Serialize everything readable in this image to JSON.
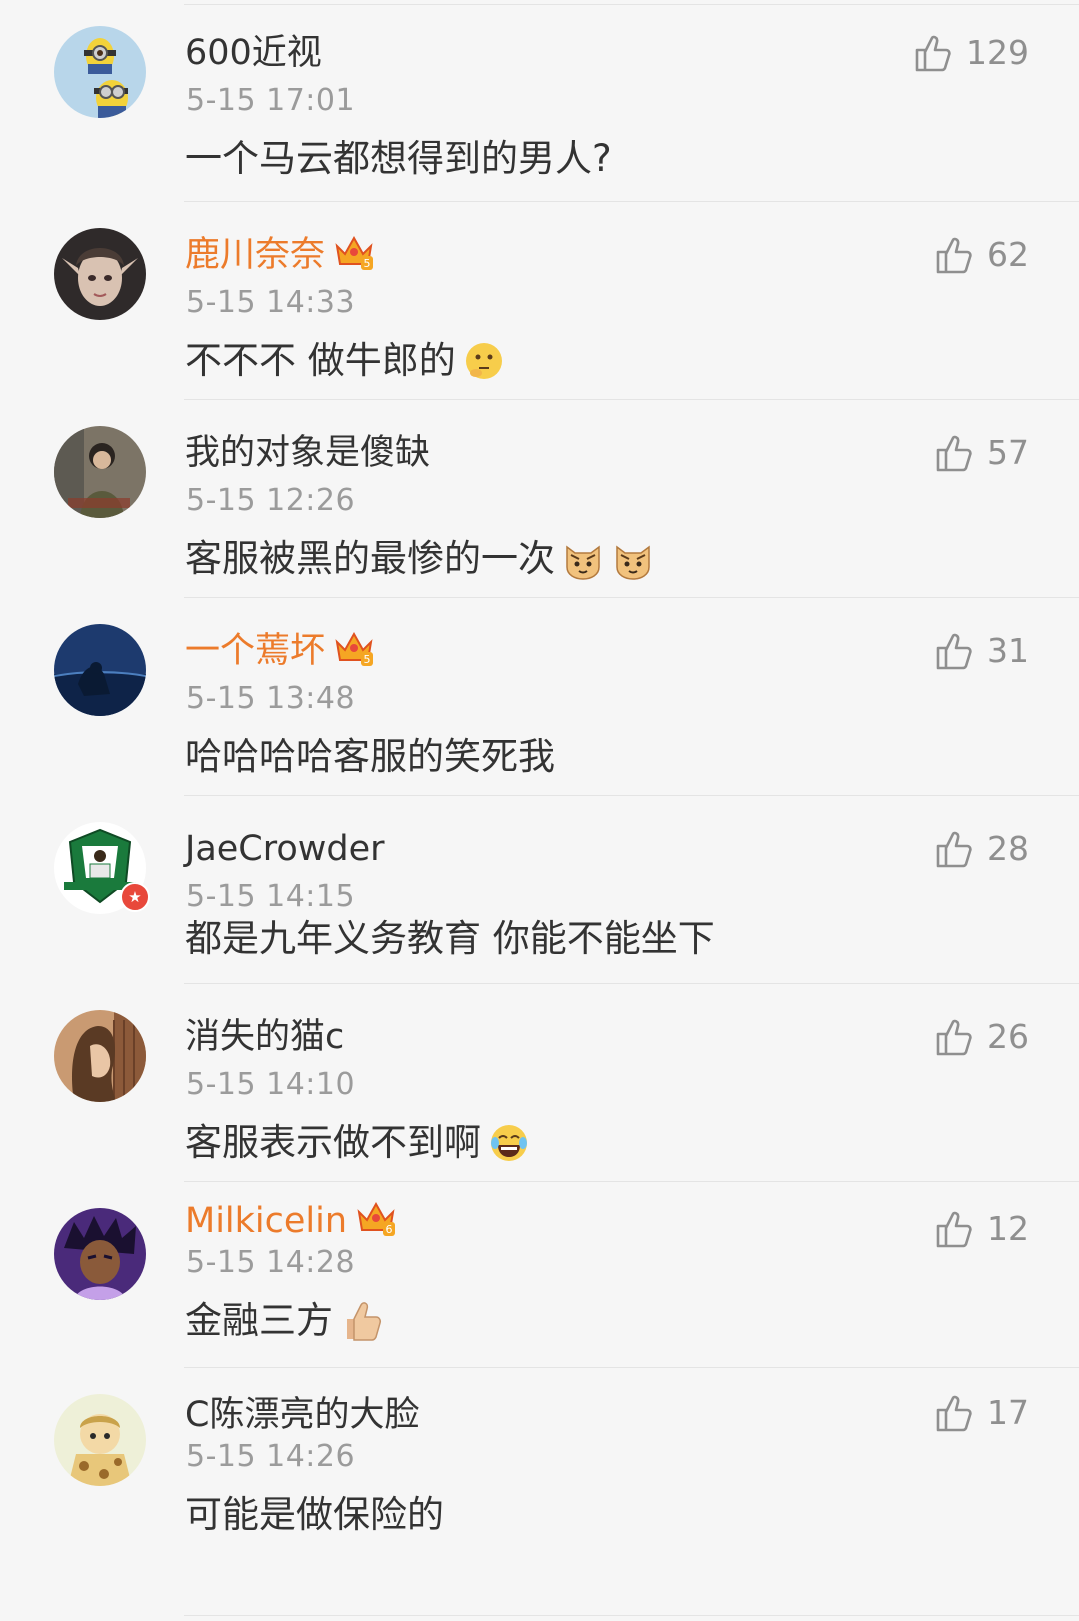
{
  "comments": [
    {
      "user": "600近视",
      "vip": false,
      "time": "5-15 17:01",
      "text": "一个马云都想得到的男人?",
      "likes": "129",
      "emoji": [],
      "avatar": "minion-avatar"
    },
    {
      "user": "鹿川奈奈",
      "vip": true,
      "vip_level": "5",
      "time": "5-15 14:33",
      "text": "不不不 做牛郎的",
      "likes": "62",
      "emoji": [
        "thinking-emoji"
      ],
      "avatar": "elf-girl-avatar"
    },
    {
      "user": "我的对象是傻缺",
      "vip": false,
      "time": "5-15 12:26",
      "text": "客服被黑的最惨的一次",
      "likes": "57",
      "emoji": [
        "cat-face-emoji",
        "cat-face-emoji"
      ],
      "avatar": "photo-avatar"
    },
    {
      "user": "一个蔫坏",
      "vip": true,
      "vip_level": "5",
      "time": "5-15 13:48",
      "text": "哈哈哈哈客服的笑死我",
      "likes": "31",
      "emoji": [],
      "avatar": "blue-sea-avatar"
    },
    {
      "user": "JaeCrowder",
      "vip": false,
      "verified": true,
      "time": "5-15 14:15",
      "text": "都是九年义务教育 你能不能坐下",
      "likes": "28",
      "emoji": [],
      "avatar": "jersey-logo-avatar"
    },
    {
      "user": "消失的猫c",
      "vip": false,
      "time": "5-15 14:10",
      "text": "客服表示做不到啊",
      "likes": "26",
      "emoji": [
        "laughing-tears-emoji"
      ],
      "avatar": "girl-profile-avatar"
    },
    {
      "user": "Milkicelin",
      "vip": true,
      "vip_level": "6",
      "time": "5-15 14:28",
      "text": "金融三方",
      "likes": "12",
      "emoji": [
        "thumbs-up-emoji"
      ],
      "avatar": "anime-boy-avatar"
    },
    {
      "user": "C陈漂亮的大脸",
      "vip": false,
      "time": "5-15 14:26",
      "text": "可能是做保险的",
      "likes": "17",
      "emoji": [],
      "avatar": "giraffe-avatar"
    }
  ],
  "colors": {
    "vip_name": "#ec7b2b",
    "normal_name": "#333333",
    "meta": "#9b9b9b",
    "background": "#f6f6f6",
    "divider": "#e4e4e4"
  }
}
